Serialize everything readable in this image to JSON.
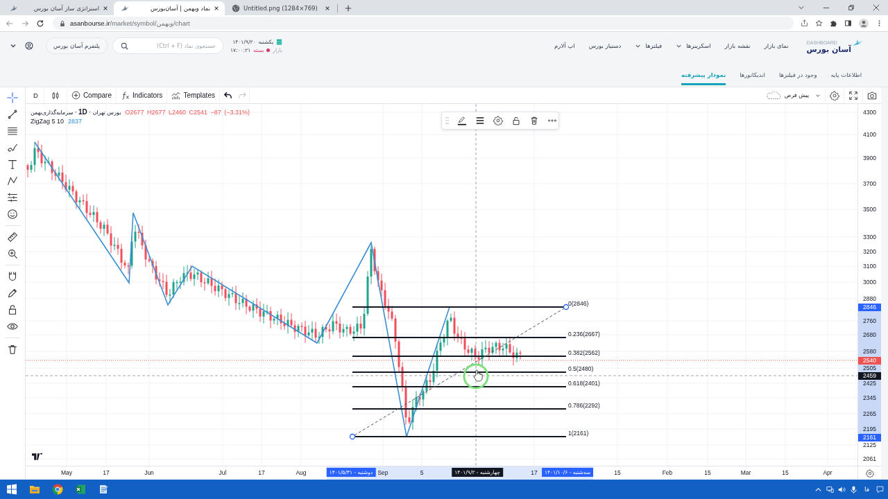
{
  "browser": {
    "tabs": [
      {
        "title": "Untitled.png (1284×769)",
        "kind": "web",
        "selected": false
      },
      {
        "title": "نماد وبهمن | آسان‌بورس",
        "kind": "site",
        "selected": true
      },
      {
        "title": "استراتژی ساز آسان بورس",
        "kind": "site",
        "selected": false
      }
    ],
    "address": {
      "host": "asanbourse.ir",
      "path": "/market/symbol/وبهمن/chart"
    }
  },
  "site": {
    "logo": {
      "tagline": "DASHBOARD",
      "name": "آسان بورس"
    },
    "nav": [
      {
        "label": "نمای بازار",
        "dropdown": false
      },
      {
        "label": "نقشه بازار",
        "dropdown": false
      },
      {
        "label": "اسکرینرها",
        "dropdown": true
      },
      {
        "label": "فیلترها",
        "dropdown": true
      },
      {
        "label": "دستیار بورس",
        "dropdown": false
      },
      {
        "label": "اپ آلارم",
        "dropdown": false
      }
    ],
    "market": {
      "day": "یکشنبه",
      "date": "۱۴۰۱/۹/۲۰",
      "label": "بازار",
      "status": "بسته",
      "time": "۱۷:۰۰:۲۱"
    },
    "search": {
      "placeholder": "جستجوی نماد (Ctrl + F)"
    },
    "platform_button": "پلتفرم آسان بورس",
    "tabs": [
      {
        "label": "اطلاعات پایه",
        "selected": false
      },
      {
        "label": "وجود در فیلترها",
        "selected": false
      },
      {
        "label": "اندیکاتورها",
        "selected": false
      },
      {
        "label": "نمودار پیشرفته",
        "selected": true
      }
    ]
  },
  "chart": {
    "toolbar": {
      "interval": "D",
      "compare": "Compare",
      "indicators": "Indicators",
      "templates": "Templates",
      "history": [
        {
          "kind": "undo",
          "disabled": false
        },
        {
          "kind": "redo",
          "disabled": true
        }
      ],
      "layout": "پیش فرض"
    },
    "legend": {
      "title": "بورس تهران · **1D** · سرمایه‌گذاری‌بهمن",
      "quote": "O2677 H2677 L2460 C2541 −87 (−3.31%)",
      "indicator": {
        "name": "ZigZag 5 10",
        "value": "2837"
      }
    },
    "fib_levels": [
      "0(2846)",
      "0.236(2667)",
      "0.382(2562)",
      "0.5(2480)",
      "0.618(2401)",
      "0.786(2292)",
      "1(2161)"
    ],
    "price_axis": [
      {
        "label": "4300",
        "kind": "tick"
      },
      {
        "label": "4100",
        "kind": "tick"
      },
      {
        "label": "3900",
        "kind": "tick"
      },
      {
        "label": "3700",
        "kind": "tick"
      },
      {
        "label": "3500",
        "kind": "tick"
      },
      {
        "label": "3300",
        "kind": "tick"
      },
      {
        "label": "3200",
        "kind": "tick"
      },
      {
        "label": "3100",
        "kind": "tick"
      },
      {
        "label": "3000",
        "kind": "tick"
      },
      {
        "label": "2880",
        "kind": "tick"
      },
      {
        "label": "2846",
        "kind": "badge",
        "color": "#2962ff"
      },
      {
        "label": "2760",
        "kind": "tick"
      },
      {
        "label": "2680",
        "kind": "tick"
      },
      {
        "label": "2580",
        "kind": "tick"
      },
      {
        "label": "2540",
        "kind": "badge",
        "color": "#ef5350"
      },
      {
        "label": "2505",
        "kind": "tick"
      },
      {
        "label": "2459",
        "kind": "badge",
        "color": "#131722"
      },
      {
        "label": "2425",
        "kind": "tick"
      },
      {
        "label": "2345",
        "kind": "tick"
      },
      {
        "label": "2265",
        "kind": "tick"
      },
      {
        "label": "2195",
        "kind": "tick"
      },
      {
        "label": "2161",
        "kind": "badge",
        "color": "#2962ff"
      },
      {
        "label": "2125",
        "kind": "tick"
      },
      {
        "label": "2061",
        "kind": "tick"
      }
    ],
    "time_axis": [
      {
        "label": "Apr",
        "kind": "tick"
      },
      {
        "label": "15",
        "kind": "tick"
      },
      {
        "label": "Mar",
        "kind": "tick"
      },
      {
        "label": "15",
        "kind": "tick"
      },
      {
        "label": "Feb",
        "kind": "tick"
      },
      {
        "label": "15",
        "kind": "tick"
      },
      {
        "label": "سه‌شنبه - ۱۴۰۱/۱۰/۶",
        "kind": "badge",
        "color": "#2962ff"
      },
      {
        "label": "17",
        "kind": "tick"
      },
      {
        "label": "چهارشنبه - ۱۴۰۱/۹/۲",
        "kind": "badge",
        "color": "#131722"
      },
      {
        "label": "5",
        "kind": "tick"
      },
      {
        "label": "Sep",
        "kind": "tick"
      },
      {
        "label": "دوشنبه - ۱۴۰۱/۵/۳۱",
        "kind": "badge",
        "color": "#2962ff"
      },
      {
        "label": "Aug",
        "kind": "tick"
      },
      {
        "label": "17",
        "kind": "tick"
      },
      {
        "label": "Jul",
        "kind": "tick"
      },
      {
        "label": "Jun",
        "kind": "tick"
      },
      {
        "label": "17",
        "kind": "tick"
      },
      {
        "label": "May",
        "kind": "tick"
      }
    ]
  },
  "taskbar": {
    "language": "فا"
  }
}
